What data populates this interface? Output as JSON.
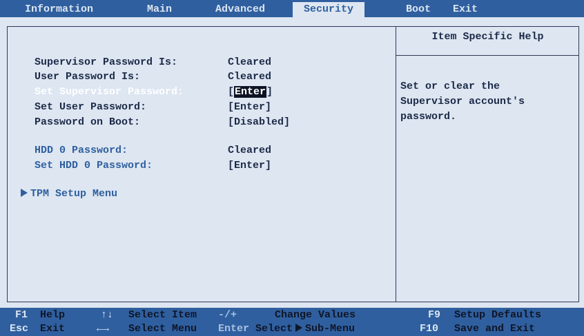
{
  "tabs": [
    {
      "label": "Information"
    },
    {
      "label": "Main"
    },
    {
      "label": "Advanced"
    },
    {
      "label": "Security"
    },
    {
      "label": "Boot"
    },
    {
      "label": "Exit"
    }
  ],
  "settings": [
    {
      "label": "Supervisor Password Is:",
      "value": "Cleared"
    },
    {
      "label": "User Password Is:",
      "value": "Cleared"
    },
    {
      "label": "Set Supervisor Password:",
      "value_pre": "[",
      "value_hl": "Enter",
      "value_post": "]"
    },
    {
      "label": "Set User Password:",
      "value": "[Enter]"
    },
    {
      "label": "Password on Boot:",
      "value": "[Disabled]"
    },
    {
      "label": "HDD 0 Password:",
      "value": "Cleared"
    },
    {
      "label": "Set HDD 0 Password:",
      "value": "[Enter]"
    }
  ],
  "submenu": {
    "label": "TPM Setup Menu"
  },
  "help": {
    "title": "Item Specific Help",
    "text": "Set or clear the\nSupervisor account's\npassword."
  },
  "footer": {
    "row1": [
      {
        "key": "F1",
        "desc": "Help"
      },
      {
        "key": "↑↓",
        "desc": "Select Item"
      },
      {
        "key": "-/+",
        "desc": "Change Values"
      },
      {
        "key": "F9",
        "desc": "Setup Defaults"
      }
    ],
    "row2": [
      {
        "key": "Esc",
        "desc": "Exit"
      },
      {
        "key": "←→",
        "desc": "Select Menu"
      },
      {
        "key": "Enter",
        "desc": "Select"
      },
      {
        "desc": "Sub-Menu"
      },
      {
        "key": "F10",
        "desc": "Save and Exit"
      }
    ]
  },
  "colors": {
    "bar_blue": "#2f5f9f",
    "panel_bg": "#dde6f1",
    "text_dark": "#1c2a48"
  }
}
